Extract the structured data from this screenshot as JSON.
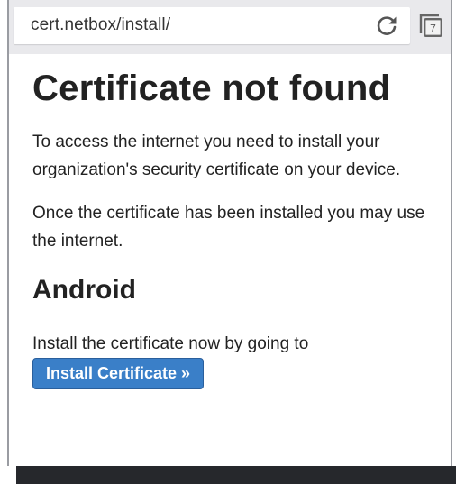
{
  "browser": {
    "url": "cert.netbox/install/",
    "tab_count": "7",
    "reload_icon": "reload-icon",
    "tabs_icon": "tabs-icon"
  },
  "page": {
    "title": "Certificate not found",
    "paragraph1": "To access the internet you need to install your organization's security certificate on your device.",
    "paragraph2": "Once the certificate has been installed you may use the internet.",
    "section_title": "Android",
    "paragraph3": "Install the certificate now by going to",
    "install_button": "Install Certificate »"
  },
  "colors": {
    "button_bg": "#3a7fc8",
    "urlbar_bg": "#e9e9ec",
    "text": "#222222"
  }
}
